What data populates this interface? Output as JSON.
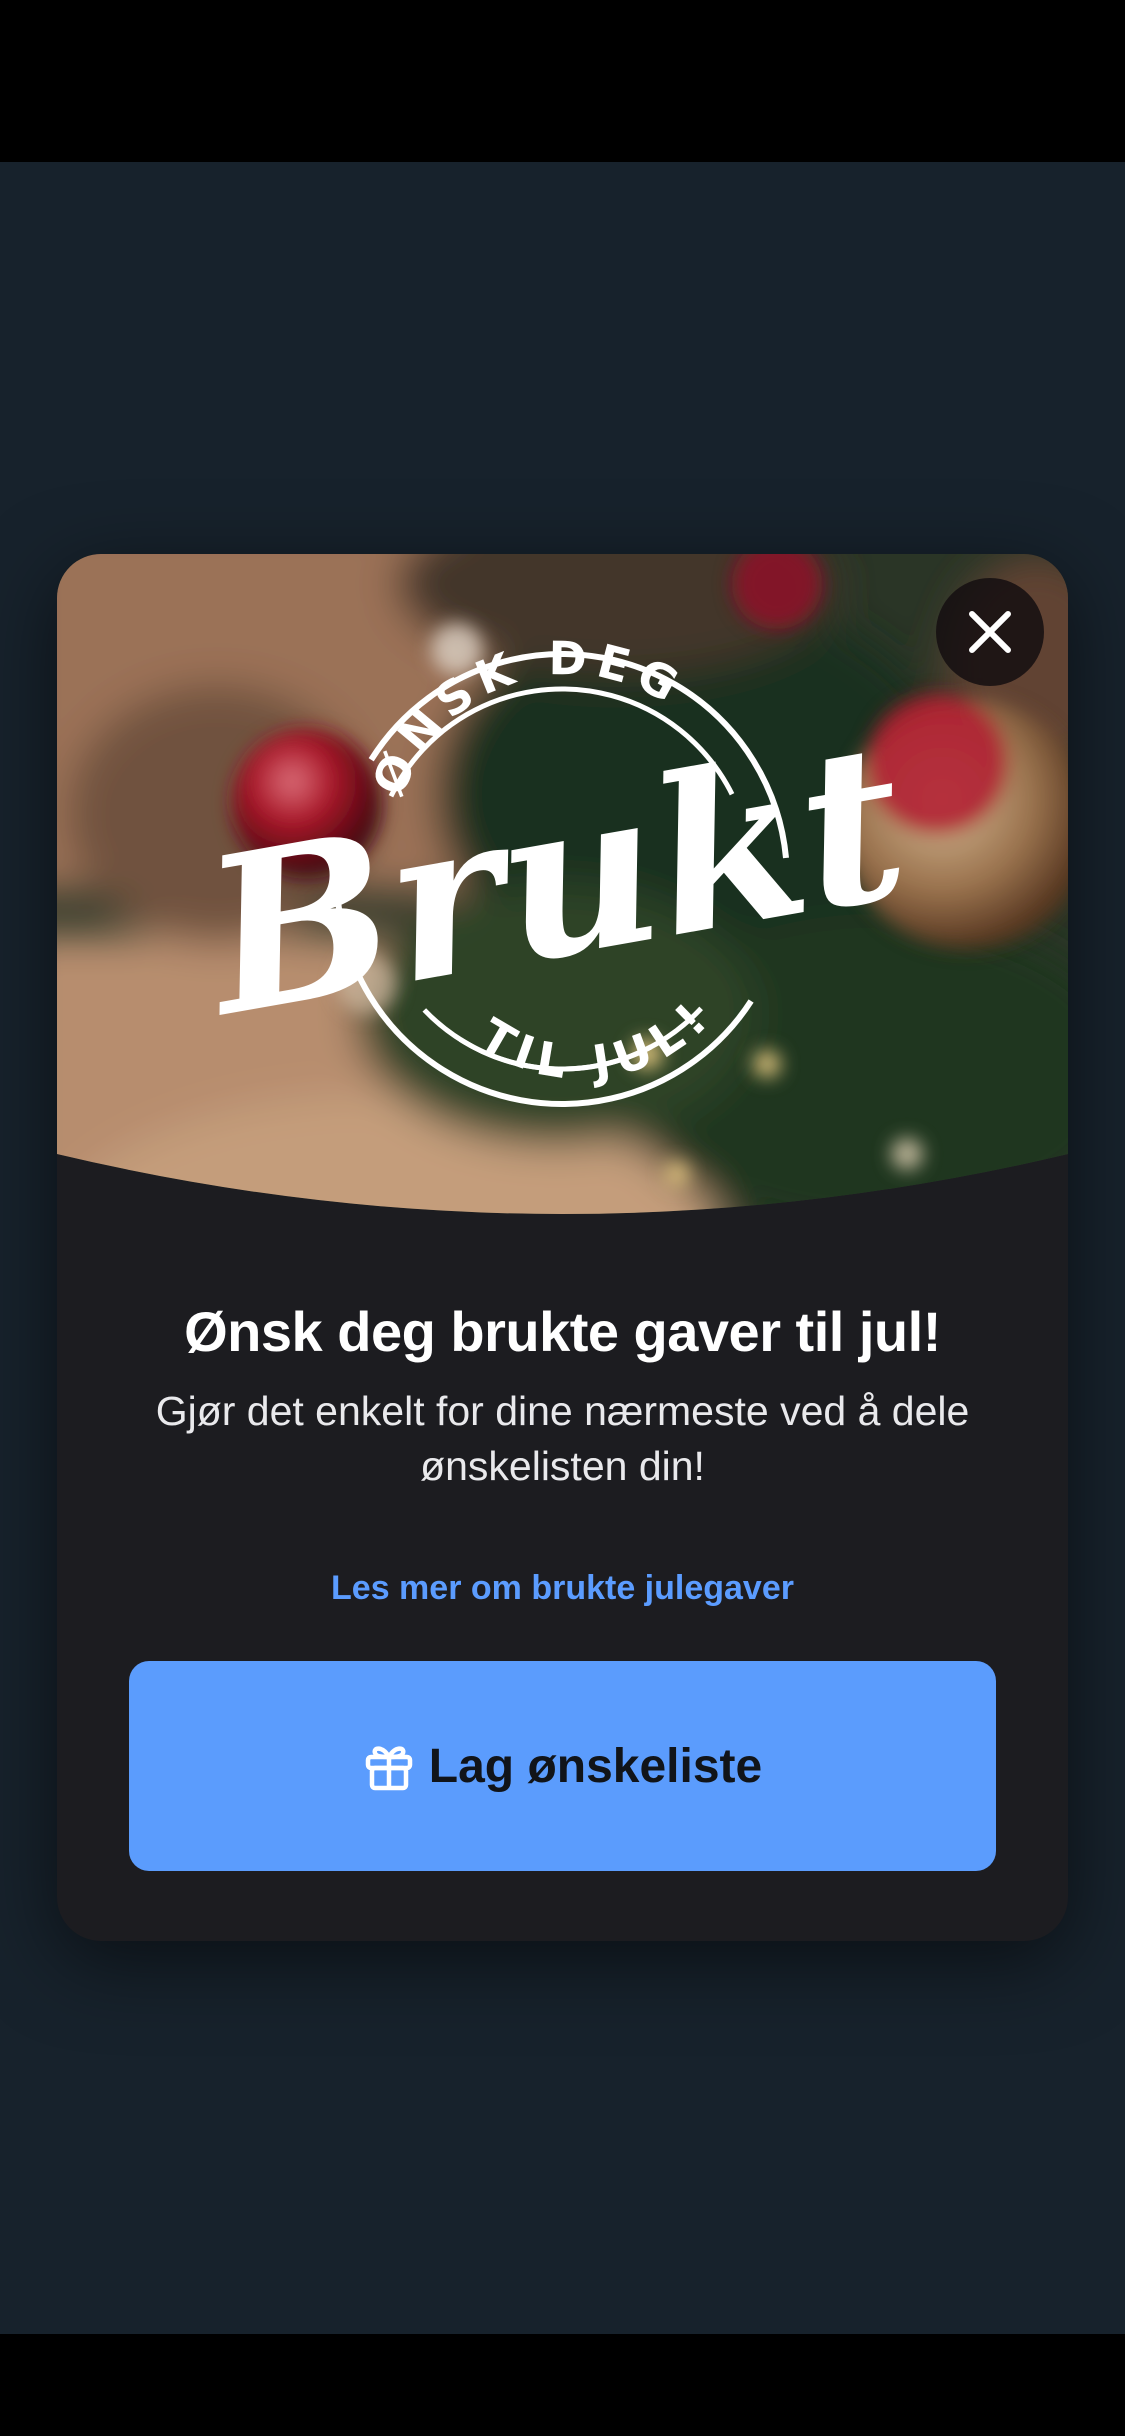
{
  "modal": {
    "badge": {
      "top_text": "ØNSK DEG",
      "brand": "Brukt",
      "bottom_text": "TIL JUL!"
    },
    "close_icon": "close-icon",
    "title": "Ønsk deg brukte gaver til jul!",
    "subtitle": "Gjør det enkelt for dine nærmeste ved å dele ønskelisten din!",
    "read_more_link": "Les mer om brukte julegaver",
    "cta": {
      "icon": "gift-icon",
      "label": "Lag ønskeliste"
    }
  },
  "colors": {
    "backdrop": "#17222c",
    "modal": "#1c1c20",
    "accent": "#5b9cfd",
    "link": "#5b9cff"
  }
}
